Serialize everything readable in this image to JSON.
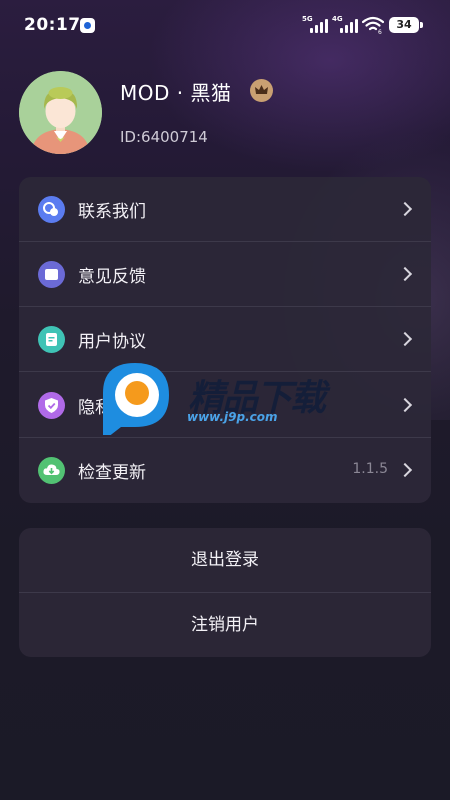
{
  "status_bar": {
    "time": "20:17",
    "signal_1": "5G",
    "signal_2": "4G",
    "wifi_level": "6",
    "battery": "34"
  },
  "profile": {
    "username": "MOD · 黑猫",
    "user_id": "ID:6400714"
  },
  "menu": {
    "items": [
      {
        "label": "联系我们",
        "icon": "contact-icon",
        "color": "#5b7cf0"
      },
      {
        "label": "意见反馈",
        "icon": "feedback-icon",
        "color": "#6b6ad6"
      },
      {
        "label": "用户协议",
        "icon": "agreement-icon",
        "color": "#3fc3b5"
      },
      {
        "label": "隐私协议",
        "icon": "privacy-icon",
        "color": "#b06ae8"
      },
      {
        "label": "检查更新",
        "icon": "update-icon",
        "color": "#52c273",
        "value": "1.1.5"
      }
    ]
  },
  "actions": {
    "logout": "退出登录",
    "deactivate": "注销用户"
  },
  "watermark": {
    "brand": "精品下载",
    "url": "www.j9p.com"
  }
}
